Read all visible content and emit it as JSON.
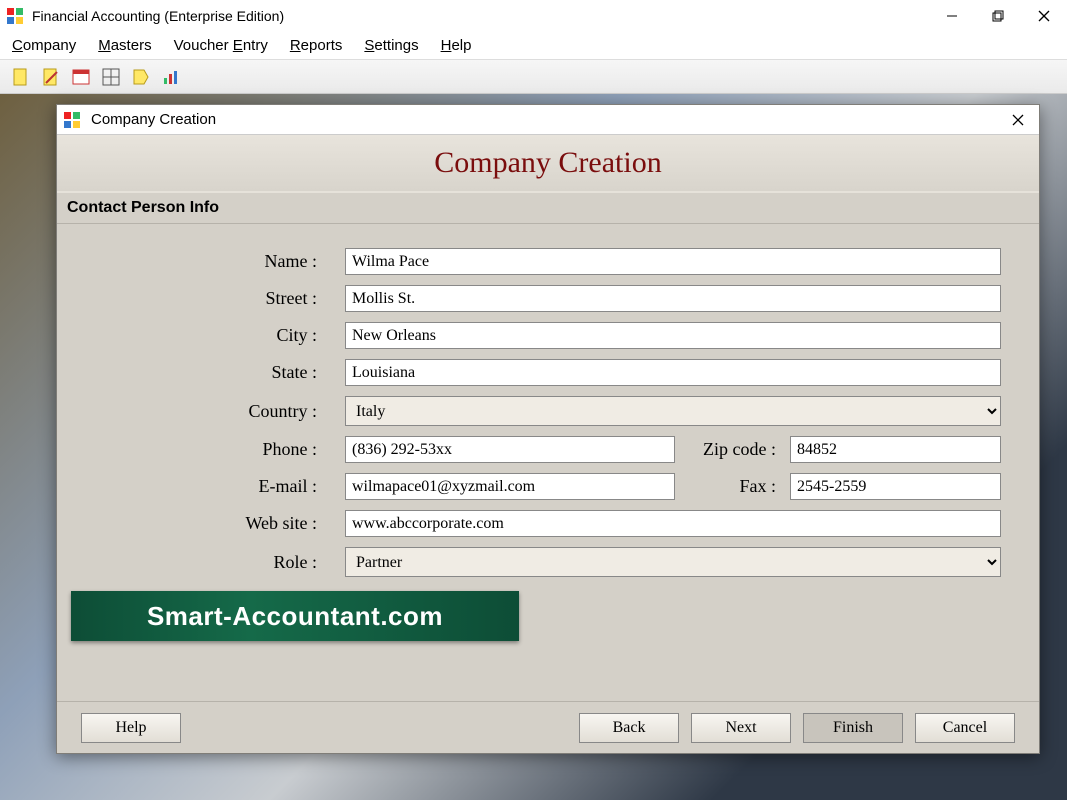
{
  "window_title": "Financial Accounting (Enterprise Edition)",
  "menu": {
    "company": "Company",
    "masters": "Masters",
    "voucher_entry": "Voucher Entry",
    "reports": "Reports",
    "settings": "Settings",
    "help": "Help"
  },
  "dialog": {
    "title": "Company Creation",
    "header": "Company Creation",
    "section_heading": "Contact Person Info",
    "labels": {
      "name": "Name :",
      "street": "Street :",
      "city": "City :",
      "state": "State :",
      "country": "Country :",
      "phone": "Phone :",
      "zip": "Zip code :",
      "email": "E-mail :",
      "fax": "Fax :",
      "website": "Web site :",
      "role": "Role :"
    },
    "values": {
      "name": "Wilma Pace",
      "street": "Mollis St.",
      "city": "New Orleans",
      "state": "Louisiana",
      "country": "Italy",
      "phone": "(836) 292-53xx",
      "zip": "84852",
      "email": "wilmapace01@xyzmail.com",
      "fax": "2545-2559",
      "website": "www.abccorporate.com",
      "role": "Partner"
    },
    "buttons": {
      "help": "Help",
      "back": "Back",
      "next": "Next",
      "finish": "Finish",
      "cancel": "Cancel"
    }
  },
  "watermark": "Smart-Accountant.com"
}
